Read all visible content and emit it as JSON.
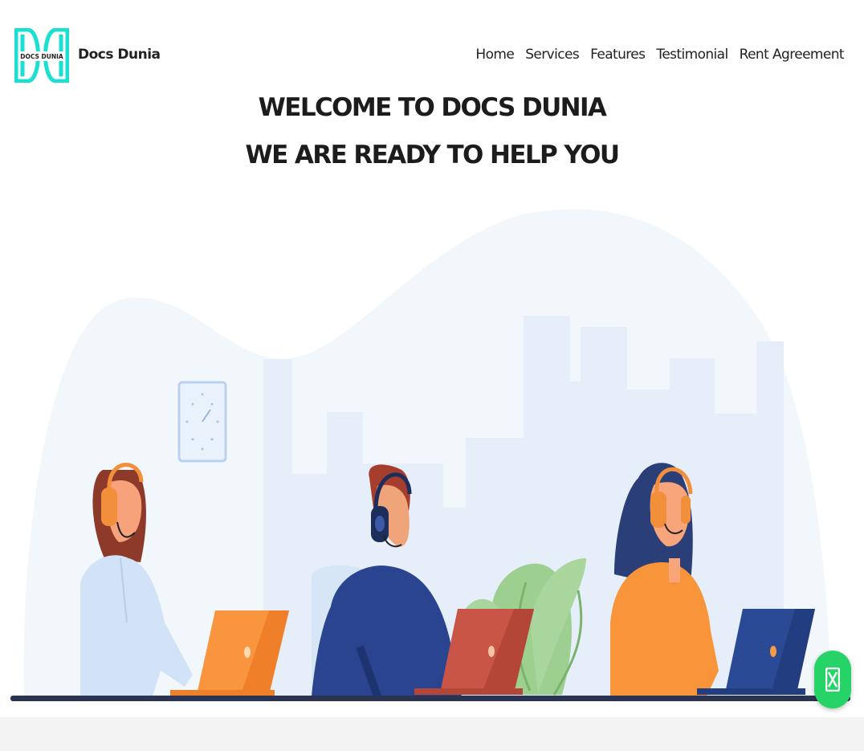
{
  "brand": {
    "logo_text": "DOCS DUNIA",
    "name": "Docs Dunia"
  },
  "nav": {
    "items": [
      "Home",
      "Services",
      "Features",
      "Testimonial",
      "Rent Agreement"
    ]
  },
  "hero": {
    "line1": "WELCOME TO DOCS DUNIA",
    "line2": "WE ARE READY TO HELP YOU"
  },
  "colors": {
    "logo_teal": "#19e0d0",
    "text_dark": "#1c1c1c",
    "fab_green": "#25d366",
    "backdrop": "#f2f7fc",
    "building": "#e6eefa"
  },
  "icons": {
    "floating_button": "chat-icon",
    "wall_clock": "clock-icon"
  }
}
